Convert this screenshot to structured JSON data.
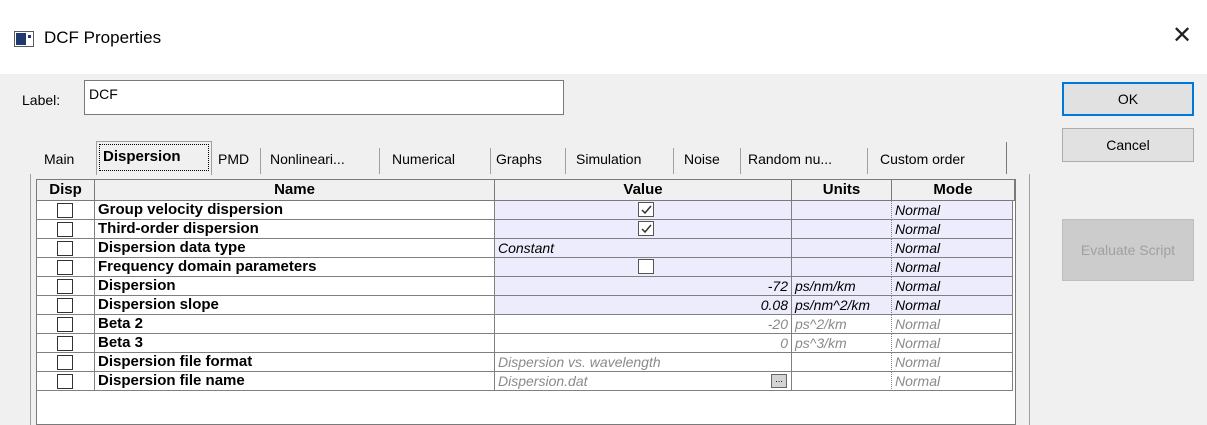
{
  "window": {
    "title": "DCF Properties",
    "close_glyph": "✕"
  },
  "label": {
    "caption": "Label:",
    "value": "DCF"
  },
  "buttons": {
    "ok": "OK",
    "cancel": "Cancel",
    "evaluate": "Evaluate Script"
  },
  "tabs": [
    {
      "label": "Main"
    },
    {
      "label": "Dispersion",
      "active": true
    },
    {
      "label": "PMD"
    },
    {
      "label": "Nonlineari..."
    },
    {
      "label": "Numerical"
    },
    {
      "label": "Graphs"
    },
    {
      "label": "Simulation"
    },
    {
      "label": "Noise"
    },
    {
      "label": "Random nu..."
    },
    {
      "label": "Custom order"
    }
  ],
  "table": {
    "headers": {
      "disp": "Disp",
      "name": "Name",
      "value": "Value",
      "units": "Units",
      "mode": "Mode"
    },
    "rows": [
      {
        "disp": false,
        "name": "Group velocity dispersion",
        "value": "",
        "value_kind": "checkbox",
        "checked": true,
        "units": "",
        "mode": "Normal",
        "enabled": true
      },
      {
        "disp": false,
        "name": "Third-order dispersion",
        "value": "",
        "value_kind": "checkbox",
        "checked": true,
        "units": "",
        "mode": "Normal",
        "enabled": true
      },
      {
        "disp": false,
        "name": "Dispersion data type",
        "value": "Constant",
        "value_kind": "text",
        "units": "",
        "mode": "Normal",
        "enabled": true
      },
      {
        "disp": false,
        "name": "Frequency domain parameters",
        "value": "",
        "value_kind": "checkbox",
        "checked": false,
        "units": "",
        "mode": "Normal",
        "enabled": true
      },
      {
        "disp": false,
        "name": "Dispersion",
        "value": "-72",
        "value_kind": "number",
        "units": "ps/nm/km",
        "mode": "Normal",
        "enabled": true
      },
      {
        "disp": false,
        "name": "Dispersion slope",
        "value": "0.08",
        "value_kind": "number",
        "units": "ps/nm^2/km",
        "mode": "Normal",
        "enabled": true
      },
      {
        "disp": false,
        "name": "Beta 2",
        "value": "-20",
        "value_kind": "number",
        "units": "ps^2/km",
        "mode": "Normal",
        "enabled": false
      },
      {
        "disp": false,
        "name": "Beta 3",
        "value": "0",
        "value_kind": "number",
        "units": "ps^3/km",
        "mode": "Normal",
        "enabled": false
      },
      {
        "disp": false,
        "name": "Dispersion file format",
        "value": "Dispersion vs. wavelength",
        "value_kind": "text",
        "units": "",
        "mode": "Normal",
        "enabled": false
      },
      {
        "disp": false,
        "name": "Dispersion file name",
        "value": "Dispersion.dat",
        "value_kind": "file",
        "browse": "...",
        "units": "",
        "mode": "Normal",
        "enabled": false
      }
    ]
  },
  "colors": {
    "accent": "#0078d7",
    "editable_bg": "#ececfc",
    "disabled_text": "#8a8a8a"
  }
}
